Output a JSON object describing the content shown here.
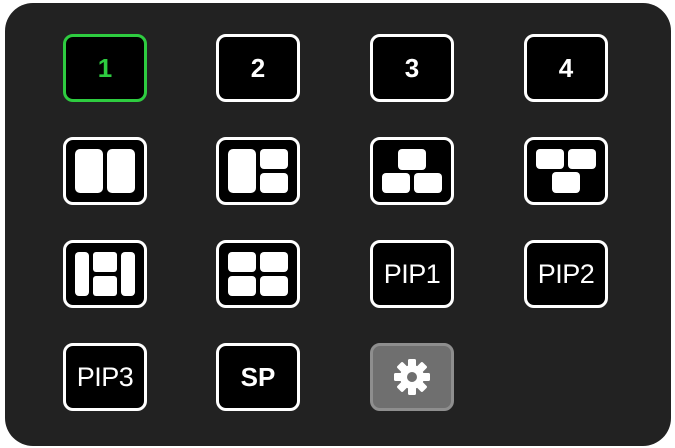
{
  "buttons": {
    "view1": {
      "label": "1",
      "active": true
    },
    "view2": {
      "label": "2"
    },
    "view3": {
      "label": "3"
    },
    "view4": {
      "label": "4"
    },
    "pip1": {
      "label": "PIP1"
    },
    "pip2": {
      "label": "PIP2"
    },
    "pip3": {
      "label": "PIP3"
    },
    "sp": {
      "label": "SP"
    }
  },
  "icons": {
    "layout_dual": "dual-split-layout-icon",
    "layout_one_plus_two": "one-plus-two-layout-icon",
    "layout_triangle_up": "triangle-up-layout-icon",
    "layout_triangle_down": "triangle-down-layout-icon",
    "layout_h_split": "h-split-layout-icon",
    "layout_quad": "quad-layout-icon",
    "settings": "gear-icon"
  },
  "colors": {
    "panel": "#222222",
    "button_bg": "#000000",
    "button_border": "#ffffff",
    "active_accent": "#2ecc40",
    "settings_bg": "#6f6f6f"
  }
}
